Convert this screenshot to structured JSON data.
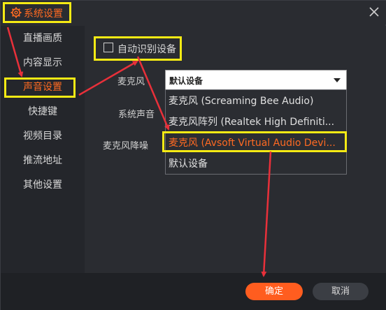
{
  "window": {
    "title": "系统设置",
    "title_icon": "gear-icon",
    "close_icon": "close-icon"
  },
  "sidebar": {
    "items": [
      {
        "label": "直播画质"
      },
      {
        "label": "内容显示"
      },
      {
        "label": "声音设置",
        "active": true
      },
      {
        "label": "快捷键"
      },
      {
        "label": "视频目录"
      },
      {
        "label": "推流地址"
      },
      {
        "label": "其他设置"
      }
    ]
  },
  "sound": {
    "auto_detect_label": "自动识别设备",
    "auto_detect_checked": false,
    "mic_label": "麦克风",
    "system_sound_label": "系统声音",
    "mic_noise_label": "麦克风降噪",
    "select_value": "默认设备",
    "options": [
      {
        "label": "麦克风 (Screaming Bee Audio)"
      },
      {
        "label": "麦克风阵列 (Realtek High Definiti..."
      },
      {
        "label": "麦克风 (Avsoft Virtual Audio Devi...",
        "selected": true
      },
      {
        "label": "默认设备"
      }
    ]
  },
  "footer": {
    "ok_label": "确定",
    "cancel_label": "取消"
  },
  "colors": {
    "accent": "#ff6a22",
    "highlight": "#f5ea14",
    "annotation_arrow": "#e8303a"
  }
}
